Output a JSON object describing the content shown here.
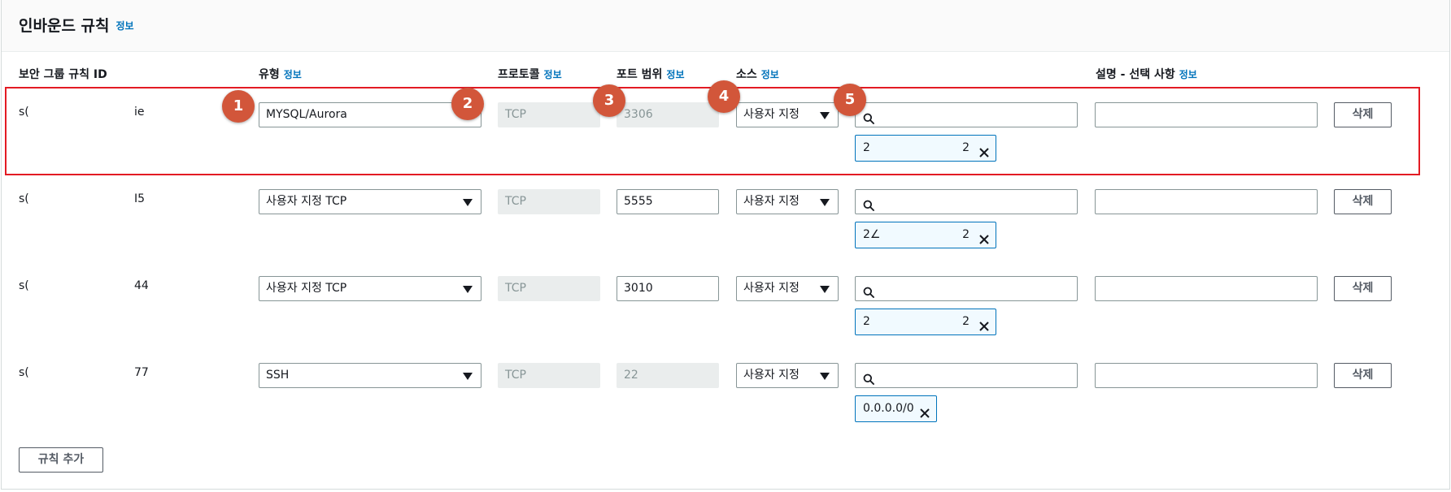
{
  "header": {
    "title": "인바운드 규칙",
    "info": "정보"
  },
  "columns": {
    "id": "보안 그룹 규칙 ID",
    "type": "유형",
    "protocol": "프로토콜",
    "port": "포트 범위",
    "source": "소스",
    "desc": "설명 - 선택 사항",
    "info": "정보"
  },
  "rows": [
    {
      "id_prefix": "s(",
      "id_suffix": "ie",
      "type": "MYSQL/Aurora",
      "protocol": "TCP",
      "port": "3306",
      "port_editable": false,
      "source": "사용자 지정",
      "search": "",
      "token_value": "2",
      "token_suffix": "2",
      "desc": "",
      "delete": "삭제"
    },
    {
      "id_prefix": "s(",
      "id_suffix": "I5",
      "type": "사용자 지정 TCP",
      "protocol": "TCP",
      "port": "5555",
      "port_editable": true,
      "source": "사용자 지정",
      "search": "",
      "token_value": "2∠",
      "token_suffix": "2",
      "desc": "",
      "delete": "삭제"
    },
    {
      "id_prefix": "s(",
      "id_suffix": "44",
      "type": "사용자 지정 TCP",
      "protocol": "TCP",
      "port": "3010",
      "port_editable": true,
      "source": "사용자 지정",
      "search": "",
      "token_value": "2",
      "token_suffix": "2",
      "desc": "",
      "delete": "삭제"
    },
    {
      "id_prefix": "s(",
      "id_suffix": "77",
      "type": "SSH",
      "protocol": "TCP",
      "port": "22",
      "port_editable": false,
      "source": "사용자 지정",
      "search": "",
      "token_value": "0.0.0.0/0",
      "token_suffix": "",
      "desc": "",
      "delete": "삭제"
    }
  ],
  "add_rule_button": "규칙 추가",
  "callouts": [
    "1",
    "2",
    "3",
    "4",
    "5"
  ],
  "colors": {
    "accent": "#0073bb",
    "highlight": "#e31b23",
    "callout": "#d2563a"
  },
  "icons": {
    "search": "search-icon",
    "dropdown": "caret-down-icon",
    "remove": "close-icon"
  }
}
